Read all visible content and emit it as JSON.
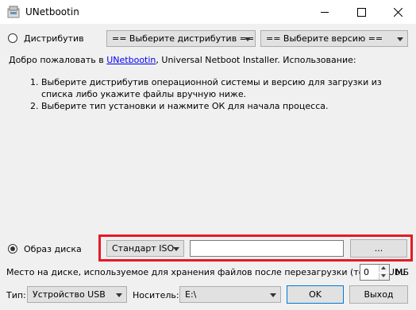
{
  "window": {
    "title": "UNetbootin"
  },
  "distro": {
    "radio_label": "Дистрибутив",
    "distribution_select": "== Выберите дистрибутив ==",
    "version_select": "== Выберите версию =="
  },
  "intro": {
    "prefix": "Добро пожаловать в ",
    "link": "UNetbootin",
    "suffix": ", Universal Netboot Installer. Использование:"
  },
  "steps": [
    {
      "num": "1.",
      "text": "Выберите дистрибутив операционной системы и версию для загрузки из списка либо укажите файлы вручную ниже."
    },
    {
      "num": "2.",
      "text": "Выберите тип установки и нажмите ОК для начала процесса."
    }
  ],
  "disk_image": {
    "radio_label": "Образ диска",
    "type_select": "Стандарт ISO",
    "path_value": "",
    "browse_label": "..."
  },
  "space": {
    "label": "Место на диске, используемое для хранения файлов после перезагрузки (только Ubu",
    "value": "0",
    "unit": "МБ"
  },
  "bottom": {
    "type_label": "Тип:",
    "type_value": "Устройство USB",
    "media_label": "Носитель:",
    "media_value": "E:\\",
    "ok_label": "OK",
    "exit_label": "Выход"
  }
}
